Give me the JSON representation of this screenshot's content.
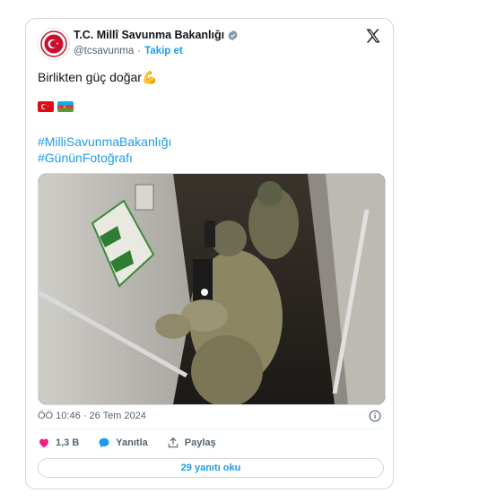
{
  "author": {
    "name": "T.C. Millî Savunma Bakanlığı",
    "handle": "@tcsavunma",
    "separator": "·",
    "follow_label": "Takip et"
  },
  "tweet": {
    "text": "Birlikten güç doğar💪",
    "flags": [
      "turkey-flag",
      "azerbaijan-flag"
    ],
    "hashtags": [
      "#MilliSavunmaBakanlığı",
      "#GününFotoğrafı"
    ],
    "timestamp": "ÖÖ 10:46 · 26 Tem 2024"
  },
  "actions": {
    "like_count": "1,3 B",
    "reply_label": "Yanıtla",
    "share_label": "Paylaş"
  },
  "read_replies_label": "29 yanıtı oku",
  "colors": {
    "accent": "#1d9bf0",
    "like": "#f91880",
    "muted": "#536471",
    "border": "#cfd9de"
  },
  "icons": [
    "ministry-logo-icon",
    "verified-badge-icon",
    "x-logo-icon",
    "info-icon",
    "heart-icon",
    "reply-bubble-icon",
    "share-icon"
  ]
}
